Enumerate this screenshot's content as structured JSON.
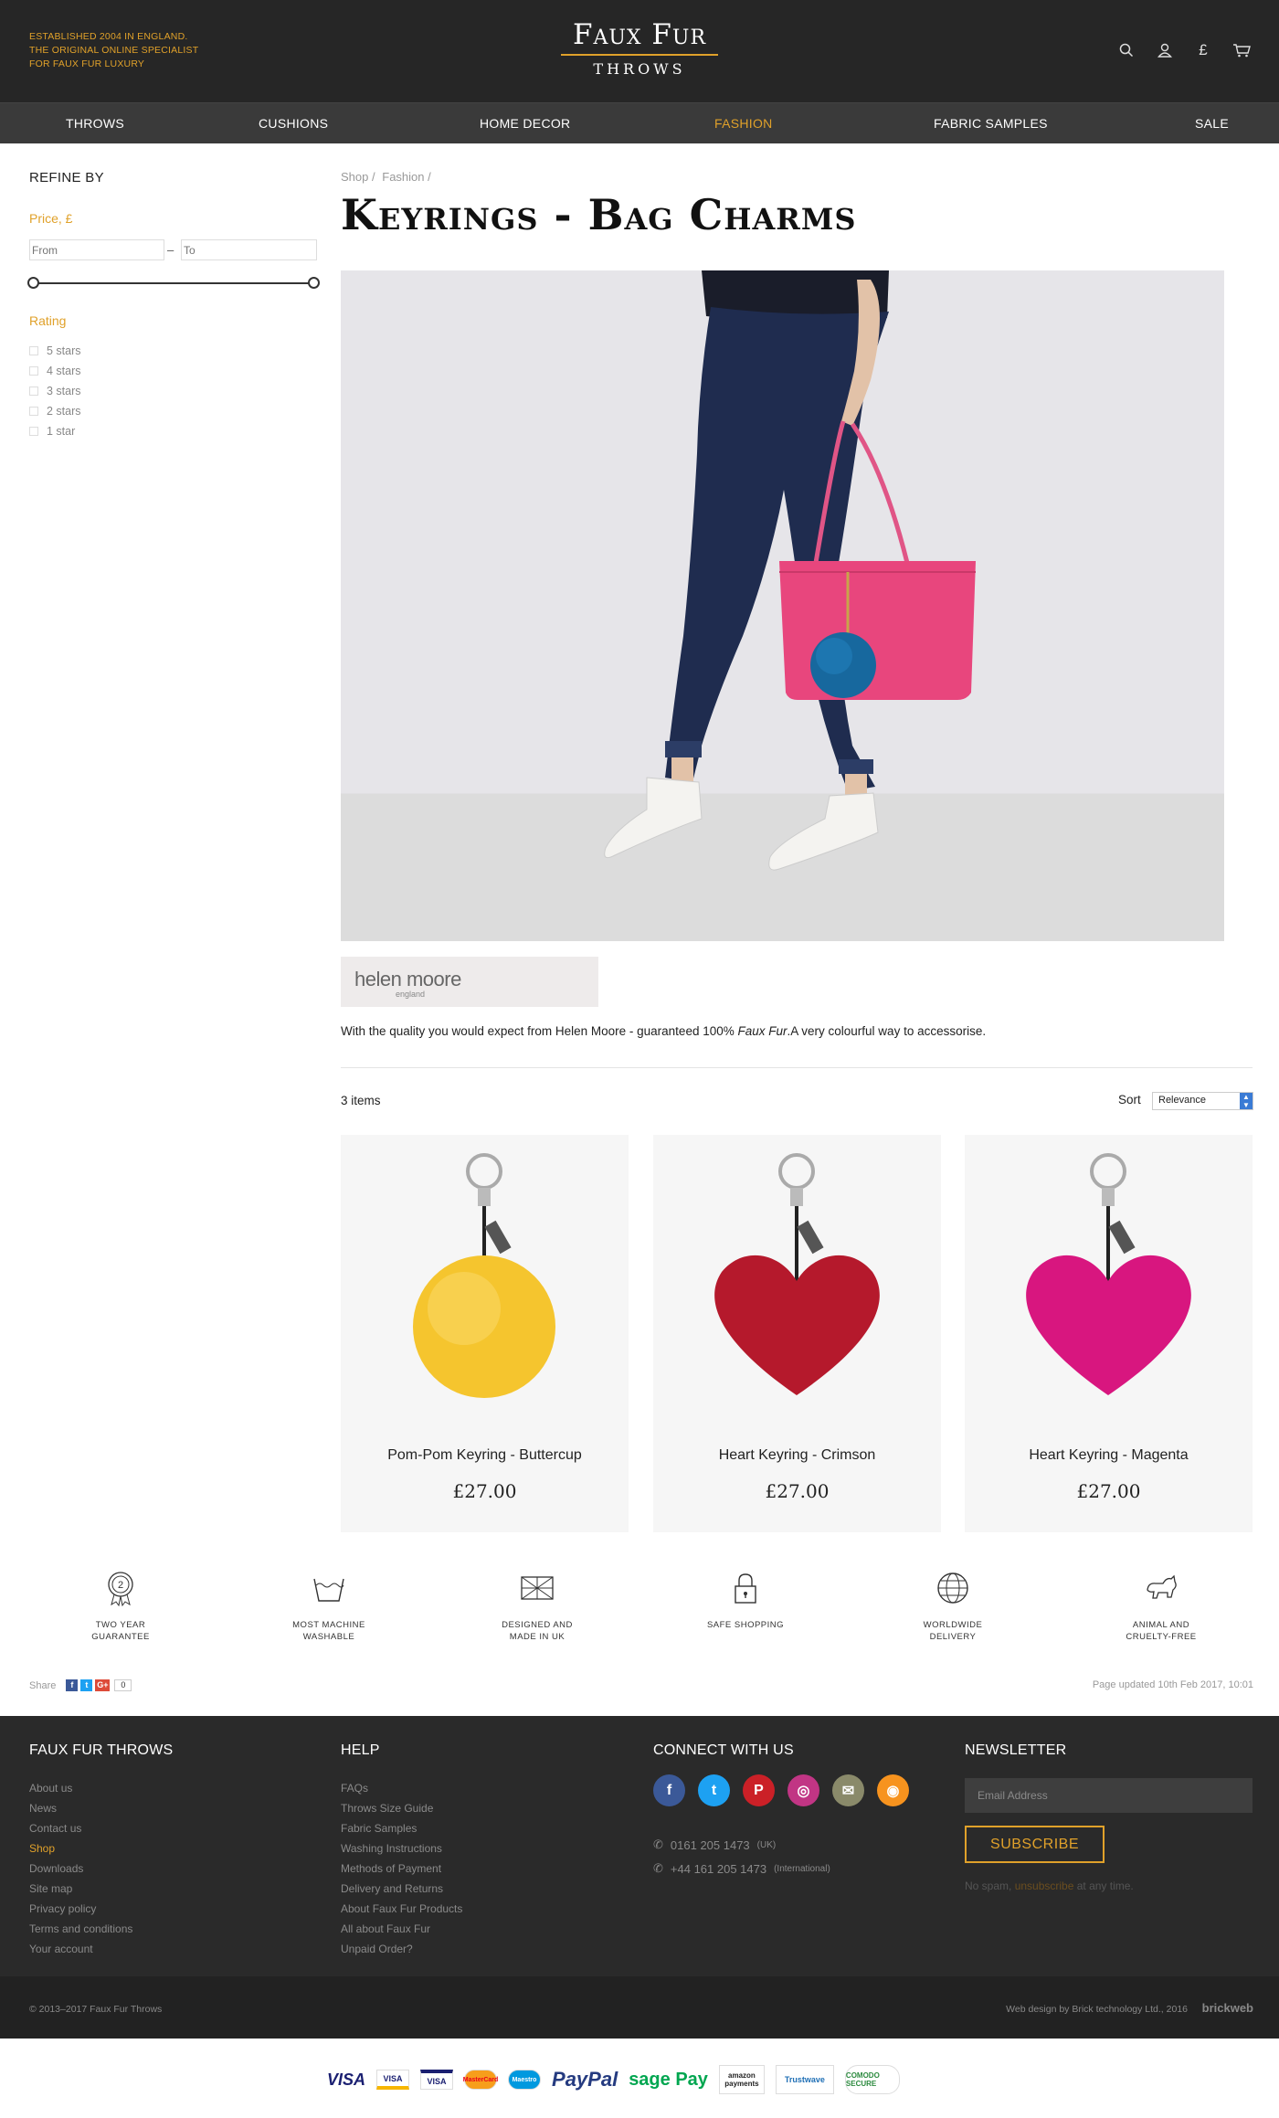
{
  "header": {
    "tagline": [
      "ESTABLISHED 2004 IN ENGLAND.",
      "THE ORIGINAL ONLINE SPECIALIST",
      "FOR FAUX FUR LUXURY"
    ],
    "logo_main": "Faux Fur",
    "logo_sub": "THROWS",
    "icons": [
      "search-icon",
      "account-icon",
      "currency-icon",
      "cart-icon"
    ],
    "currency_symbol": "£"
  },
  "nav": {
    "items": [
      {
        "label": "THROWS"
      },
      {
        "label": "CUSHIONS"
      },
      {
        "label": "HOME DECOR"
      },
      {
        "label": "FASHION",
        "active": true
      },
      {
        "label": "FABRIC SAMPLES"
      },
      {
        "label": "SALE"
      }
    ]
  },
  "sidebar": {
    "title": "REFINE BY",
    "price_heading": "Price, £",
    "from_placeholder": "From",
    "to_placeholder": "To",
    "rating_heading": "Rating",
    "ratings": [
      "5 stars",
      "4 stars",
      "3 stars",
      "2 stars",
      "1 star"
    ]
  },
  "breadcrumb": [
    "Shop",
    "/",
    "Fashion",
    "/"
  ],
  "page_title": "Keyrings - Bag Charms",
  "brand": {
    "name": "helen moore",
    "sub": "england"
  },
  "description": {
    "before": "With the quality you would expect from Helen Moore - guaranteed 100% ",
    "italic": "Faux Fur",
    "after": ".A very colourful way to accessorise."
  },
  "listing": {
    "count": "3 items",
    "sort_label": "Sort",
    "sort_value": "Relevance"
  },
  "products": [
    {
      "name": "Pom-Pom Keyring - Buttercup",
      "price": "£27.00",
      "color": "#f5c52e"
    },
    {
      "name": "Heart Keyring - Crimson",
      "price": "£27.00",
      "color": "#b5192c"
    },
    {
      "name": "Heart Keyring - Magenta",
      "price": "£27.00",
      "color": "#d8167f"
    }
  ],
  "features": [
    {
      "line1": "TWO YEAR",
      "line2": "GUARANTEE",
      "icon": "guarantee-badge-icon"
    },
    {
      "line1": "MOST MACHINE",
      "line2": "WASHABLE",
      "icon": "washing-icon"
    },
    {
      "line1": "DESIGNED AND",
      "line2": "MADE IN UK",
      "icon": "union-jack-icon"
    },
    {
      "line1": "SAFE SHOPPING",
      "line2": "",
      "icon": "padlock-icon"
    },
    {
      "line1": "WORLDWIDE",
      "line2": "DELIVERY",
      "icon": "globe-icon"
    },
    {
      "line1": "ANIMAL AND",
      "line2": "CRUELTY-FREE",
      "icon": "animal-icon"
    }
  ],
  "share": {
    "label": "Share",
    "count": "0"
  },
  "updated": "Page updated 10th Feb 2017, 10:01",
  "footer": {
    "col1": {
      "title": "FAUX FUR THROWS",
      "links": [
        "About us",
        "News",
        "Contact us",
        "Shop",
        "Downloads",
        "Site map",
        "Privacy policy",
        "Terms and conditions",
        "Your account"
      ],
      "active_index": 3
    },
    "col2": {
      "title": "HELP",
      "links": [
        "FAQs",
        "Throws Size Guide",
        "Fabric Samples",
        "Washing Instructions",
        "Methods of Payment",
        "Delivery and Returns",
        "About Faux Fur Products",
        "All about Faux Fur",
        "Unpaid Order?"
      ]
    },
    "col3": {
      "title": "CONNECT WITH US",
      "socials": [
        {
          "icon": "facebook-icon",
          "glyph": "f",
          "color": "#3b5998"
        },
        {
          "icon": "twitter-icon",
          "glyph": "t",
          "color": "#1da1f2"
        },
        {
          "icon": "pinterest-icon",
          "glyph": "P",
          "color": "#cb2027"
        },
        {
          "icon": "instagram-icon",
          "glyph": "◎",
          "color": "#c13584"
        },
        {
          "icon": "email-icon",
          "glyph": "✉",
          "color": "#8a8a6a"
        },
        {
          "icon": "rss-icon",
          "glyph": "◉",
          "color": "#f7931e"
        }
      ],
      "phone1": "0161 205 1473",
      "phone1_note": "(UK)",
      "phone2": "+44 161 205 1473",
      "phone2_note": "(International)"
    },
    "col4": {
      "title": "NEWSLETTER",
      "email_placeholder": "Email Address",
      "subscribe": "SUBSCRIBE",
      "nospam_before": "No spam, ",
      "nospam_link": "unsubscribe",
      "nospam_after": " at any time."
    }
  },
  "bottom": {
    "copyright": "© 2013–2017  Faux Fur Throws",
    "webdesign": "Web design by Brick technology Ltd., 2016",
    "brickweb": "brickweb"
  },
  "payments": [
    "VISA",
    "VISA",
    "VISA",
    "MasterCard",
    "Maestro",
    "PayPal",
    "sage Pay",
    "amazon payments",
    "Trustwave",
    "COMODO SECURE"
  ]
}
